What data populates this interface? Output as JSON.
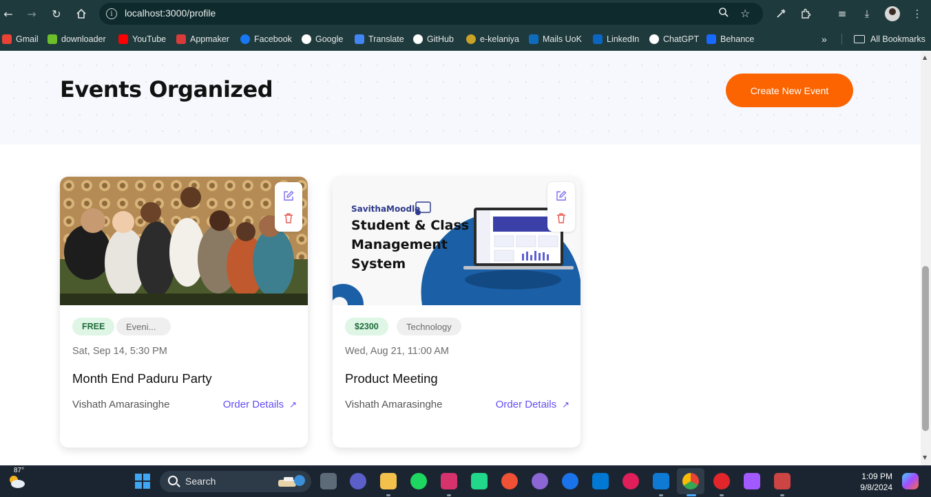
{
  "browser": {
    "url": "localhost:3000/profile",
    "bookmarks": [
      {
        "label": "Gmail",
        "icon": "gmail-icon",
        "color": "#ea4335"
      },
      {
        "label": "downloader",
        "icon": "download-arrow-icon",
        "color": "#6cbf2a"
      },
      {
        "label": "YouTube",
        "icon": "youtube-icon",
        "color": "#ff0000"
      },
      {
        "label": "Appmaker",
        "icon": "appmaker-icon",
        "color": "#d93b3b"
      },
      {
        "label": "Facebook",
        "icon": "facebook-icon",
        "color": "#1877f2"
      },
      {
        "label": "Google",
        "icon": "google-icon",
        "color": "#ffffff"
      },
      {
        "label": "Translate",
        "icon": "translate-icon",
        "color": "#4285f4"
      },
      {
        "label": "GitHub",
        "icon": "github-icon",
        "color": "#ffffff"
      },
      {
        "label": "e-kelaniya",
        "icon": "kelaniya-icon",
        "color": "#c9a227"
      },
      {
        "label": "Mails UoK",
        "icon": "outlook-icon",
        "color": "#0f6cbd"
      },
      {
        "label": "LinkedIn",
        "icon": "linkedin-icon",
        "color": "#0a66c2"
      },
      {
        "label": "ChatGPT",
        "icon": "chatgpt-icon",
        "color": "#ffffff"
      },
      {
        "label": "Behance",
        "icon": "behance-icon",
        "color": "#1769ff"
      }
    ],
    "all_bookmarks_label": "All Bookmarks"
  },
  "page": {
    "title": "Events Organized",
    "create_button": "Create New Event",
    "accent_color": "#fb6400",
    "events": [
      {
        "price": "FREE",
        "category": "Eveni...",
        "date": "Sat, Sep 14, 5:30 PM",
        "title": "Month End Paduru Party",
        "organizer": "Vishath Amarasinghe",
        "link": "Order Details"
      },
      {
        "price": "$2300",
        "category": "Technology",
        "date": "Wed, Aug 21, 11:00 AM",
        "title": "Product Meeting",
        "organizer": "Vishath Amarasinghe",
        "link": "Order Details",
        "image": {
          "brand": "SavithaMoodle",
          "headline_1": "Student & Class",
          "headline_2": "Management",
          "headline_3": "System"
        }
      }
    ]
  },
  "taskbar": {
    "temperature": "87°",
    "search_placeholder": "Search",
    "time": "1:09 PM",
    "date": "9/8/2024"
  }
}
